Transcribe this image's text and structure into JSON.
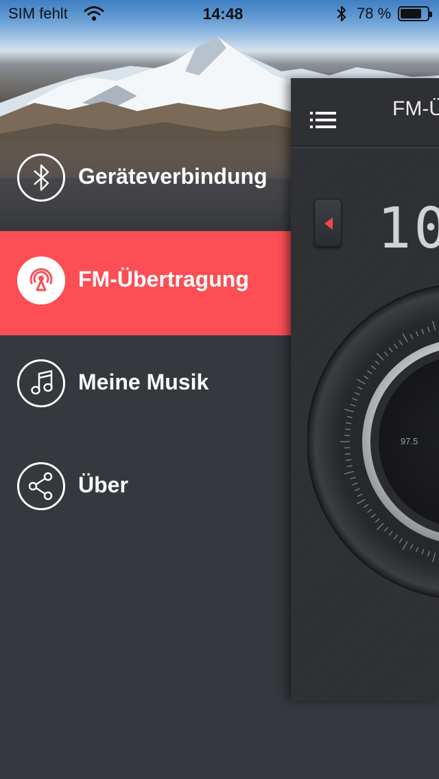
{
  "status_bar": {
    "carrier": "SIM fehlt",
    "time": "14:48",
    "battery_percent": "78 %",
    "battery_level": 0.78
  },
  "menu": {
    "items": [
      {
        "label": "Geräteverbindung",
        "icon": "bluetooth-icon",
        "selected": false
      },
      {
        "label": "FM-Übertragung",
        "icon": "broadcast-icon",
        "selected": true
      },
      {
        "label": "Meine Musik",
        "icon": "music-note-icon",
        "selected": false
      },
      {
        "label": "Über",
        "icon": "share-icon",
        "selected": false
      }
    ]
  },
  "panel": {
    "title": "FM-Ü",
    "frequency": "10",
    "dial_label": "97.5"
  },
  "colors": {
    "accent": "#fc4e54",
    "menu_background": "#35383d",
    "panel_background": "#3a3d41"
  }
}
